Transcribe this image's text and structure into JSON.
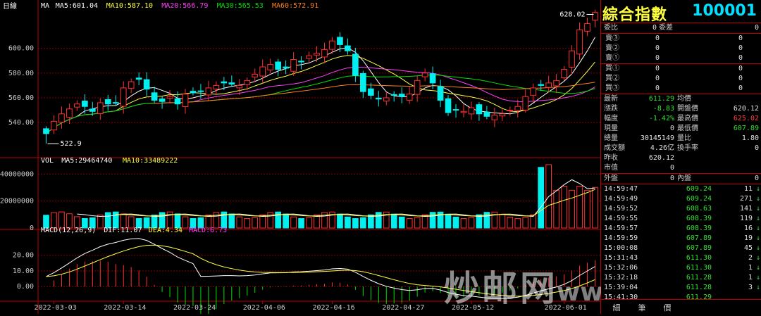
{
  "main": {
    "period_label": "日線",
    "ma_labels": [
      {
        "text": "MA",
        "color": "#ffffff"
      },
      {
        "text": "MA5:601.04",
        "color": "#ffffff"
      },
      {
        "text": "MA10:587.10",
        "color": "#ffff40"
      },
      {
        "text": "MA20:566.79",
        "color": "#ff40ff"
      },
      {
        "text": "MA30:565.53",
        "color": "#00e000"
      },
      {
        "text": "MA60:572.91",
        "color": "#ff8020"
      }
    ],
    "high_marker": "628.02",
    "low_marker": "522.9",
    "y_ticks": [
      "600.00",
      "580.00",
      "560.00",
      "540.00"
    ]
  },
  "volume": {
    "labels": [
      {
        "text": "VOL",
        "color": "#ffffff"
      },
      {
        "text": "MA5:29464740",
        "color": "#ffffff"
      },
      {
        "text": "MA10:33489222",
        "color": "#ffff40"
      }
    ],
    "y_ticks": [
      "40000000",
      "20000000",
      "0"
    ]
  },
  "macd": {
    "labels": [
      {
        "text": "MACD(12,26,9)",
        "color": "#ffffff"
      },
      {
        "text": "DIF:11.07",
        "color": "#ffffff"
      },
      {
        "text": "DEA:4.34",
        "color": "#ffff40"
      },
      {
        "text": "MACD:6.73",
        "color": "#ff40ff"
      }
    ],
    "y_ticks": [
      "20.00",
      "10.00",
      "0.00"
    ]
  },
  "x_dates": [
    "2022-03-03",
    "2022-03-14",
    "2022-03-24",
    "2022-04-06",
    "2022-04-16",
    "2022-04-27",
    "2022-05-12",
    "2022-06-01"
  ],
  "chart_data": {
    "type": "candlestick",
    "price_range": [
      515,
      630
    ],
    "closes": [
      531,
      541,
      547,
      551,
      555,
      553,
      549,
      556,
      555,
      556,
      568,
      573,
      575,
      567,
      558,
      557,
      561,
      555,
      563,
      564,
      565,
      568,
      570,
      572,
      571,
      570,
      574,
      579,
      585,
      587,
      583,
      584,
      591,
      589,
      594,
      596,
      599,
      606,
      603,
      598,
      578,
      565,
      562,
      559,
      560,
      562,
      561,
      563,
      574,
      580,
      572,
      558,
      548,
      550,
      549,
      552,
      547,
      545,
      546,
      547,
      550,
      553,
      561,
      568,
      570,
      572,
      574,
      583,
      598,
      615,
      620,
      629
    ]
  },
  "quote": {
    "name": "綜合指數",
    "code": "100001",
    "book": [
      {
        "k1": "委比",
        "v1": "0",
        "k2": "委差",
        "v2": "0"
      }
    ],
    "asks": [
      {
        "label": "賣③",
        "price": "0",
        "vol": "0"
      },
      {
        "label": "賣②",
        "price": "0",
        "vol": "0"
      },
      {
        "label": "賣①",
        "price": "0",
        "vol": "0"
      }
    ],
    "bids": [
      {
        "label": "買①",
        "price": "0",
        "vol": "0"
      },
      {
        "label": "買②",
        "price": "0",
        "vol": "0"
      },
      {
        "label": "買③",
        "price": "0",
        "vol": "0"
      }
    ],
    "stats": [
      {
        "k1": "最新",
        "v1": "611.29",
        "c1": "g",
        "k2": "均價",
        "v2": "",
        "c2": "w"
      },
      {
        "k1": "漲跌",
        "v1": "-8.83",
        "c1": "g",
        "k2": "開盤價",
        "v2": "620.12",
        "c2": "w"
      },
      {
        "k1": "幅度",
        "v1": "-1.42%",
        "c1": "g",
        "k2": "最高價",
        "v2": "625.02",
        "c2": "r"
      },
      {
        "k1": "現量",
        "v1": "0",
        "c1": "w",
        "k2": "最低價",
        "v2": "607.89",
        "c2": "g"
      },
      {
        "k1": "總量",
        "v1": "30145149",
        "c1": "w",
        "k2": "量比",
        "v2": "1.80",
        "c2": "w"
      },
      {
        "k1": "成交額",
        "v1": "4.26亿",
        "c1": "w",
        "k2": "換手率",
        "v2": "0",
        "c2": "w"
      },
      {
        "k1": "昨收",
        "v1": "620.12",
        "c1": "w",
        "k2": "",
        "v2": "",
        "c2": "w"
      },
      {
        "k1": "市值",
        "v1": "0",
        "c1": "w",
        "k2": "",
        "v2": "",
        "c2": "w"
      },
      {
        "k1": "外盤",
        "v1": "0",
        "c1": "w",
        "k2": "內盤",
        "v2": "0",
        "c2": "w"
      }
    ],
    "ticks": [
      {
        "time": "14:59:47",
        "price": "609.24",
        "vol": "11",
        "arrow": "↓"
      },
      {
        "time": "14:59:49",
        "price": "609.24",
        "vol": "271",
        "arrow": "↓"
      },
      {
        "time": "14:59:52",
        "price": "608.63",
        "vol": "141",
        "arrow": "↓"
      },
      {
        "time": "14:59:55",
        "price": "608.39",
        "vol": "119",
        "arrow": "↓"
      },
      {
        "time": "14:59:57",
        "price": "608.39",
        "vol": "16",
        "arrow": "↓"
      },
      {
        "time": "14:59:59",
        "price": "607.89",
        "vol": "19",
        "arrow": "↓"
      },
      {
        "time": "15:00:08",
        "price": "607.89",
        "vol": "45",
        "arrow": "↓"
      },
      {
        "time": "15:31:43",
        "price": "611.30",
        "vol": "2",
        "arrow": "↓"
      },
      {
        "time": "15:32:06",
        "price": "611.30",
        "vol": "1",
        "arrow": "↓"
      },
      {
        "time": "15:32:18",
        "price": "611.28",
        "vol": "1",
        "arrow": "↓"
      },
      {
        "time": "15:39:04",
        "price": "611.28",
        "vol": "3",
        "arrow": "↓"
      },
      {
        "time": "15:41:30",
        "price": "611.29",
        "vol": "",
        "arrow": ""
      }
    ],
    "tabs": [
      "細",
      "筆",
      "價"
    ]
  },
  "watermark": {
    "left": "炒邮网",
    "right": "www.cjiyou.net"
  }
}
